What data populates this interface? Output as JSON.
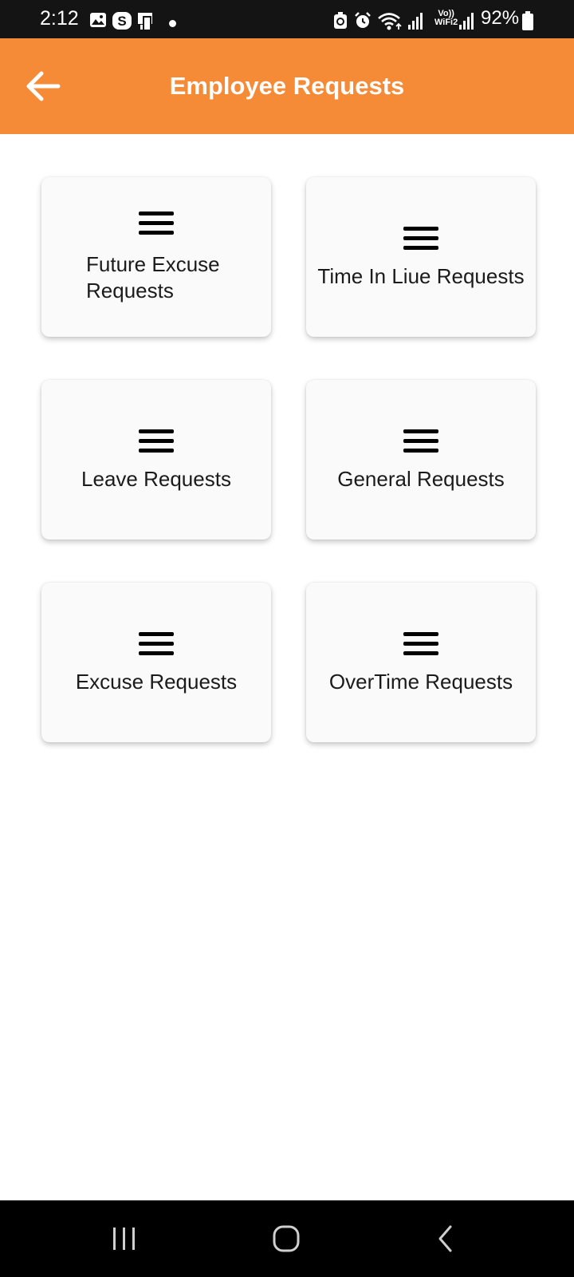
{
  "status_bar": {
    "time": "2:12",
    "wifi_label_top": "Vo))",
    "wifi_label_bottom": "WiFi2",
    "battery_percent": "92%"
  },
  "app_bar": {
    "title": "Employee Requests",
    "background_color": "#f58a37",
    "back_icon": "arrow-left-icon"
  },
  "cards": [
    {
      "label": "Future Excuse Requests",
      "icon": "menu-icon"
    },
    {
      "label": "Time In Liue Requests",
      "icon": "menu-icon"
    },
    {
      "label": "Leave Requests",
      "icon": "menu-icon"
    },
    {
      "label": "General Requests",
      "icon": "menu-icon"
    },
    {
      "label": "Excuse Requests",
      "icon": "menu-icon"
    },
    {
      "label": "OverTime Requests",
      "icon": "menu-icon"
    }
  ],
  "nav_bar": {
    "buttons": [
      "recent-apps-icon",
      "home-icon",
      "back-icon"
    ]
  }
}
